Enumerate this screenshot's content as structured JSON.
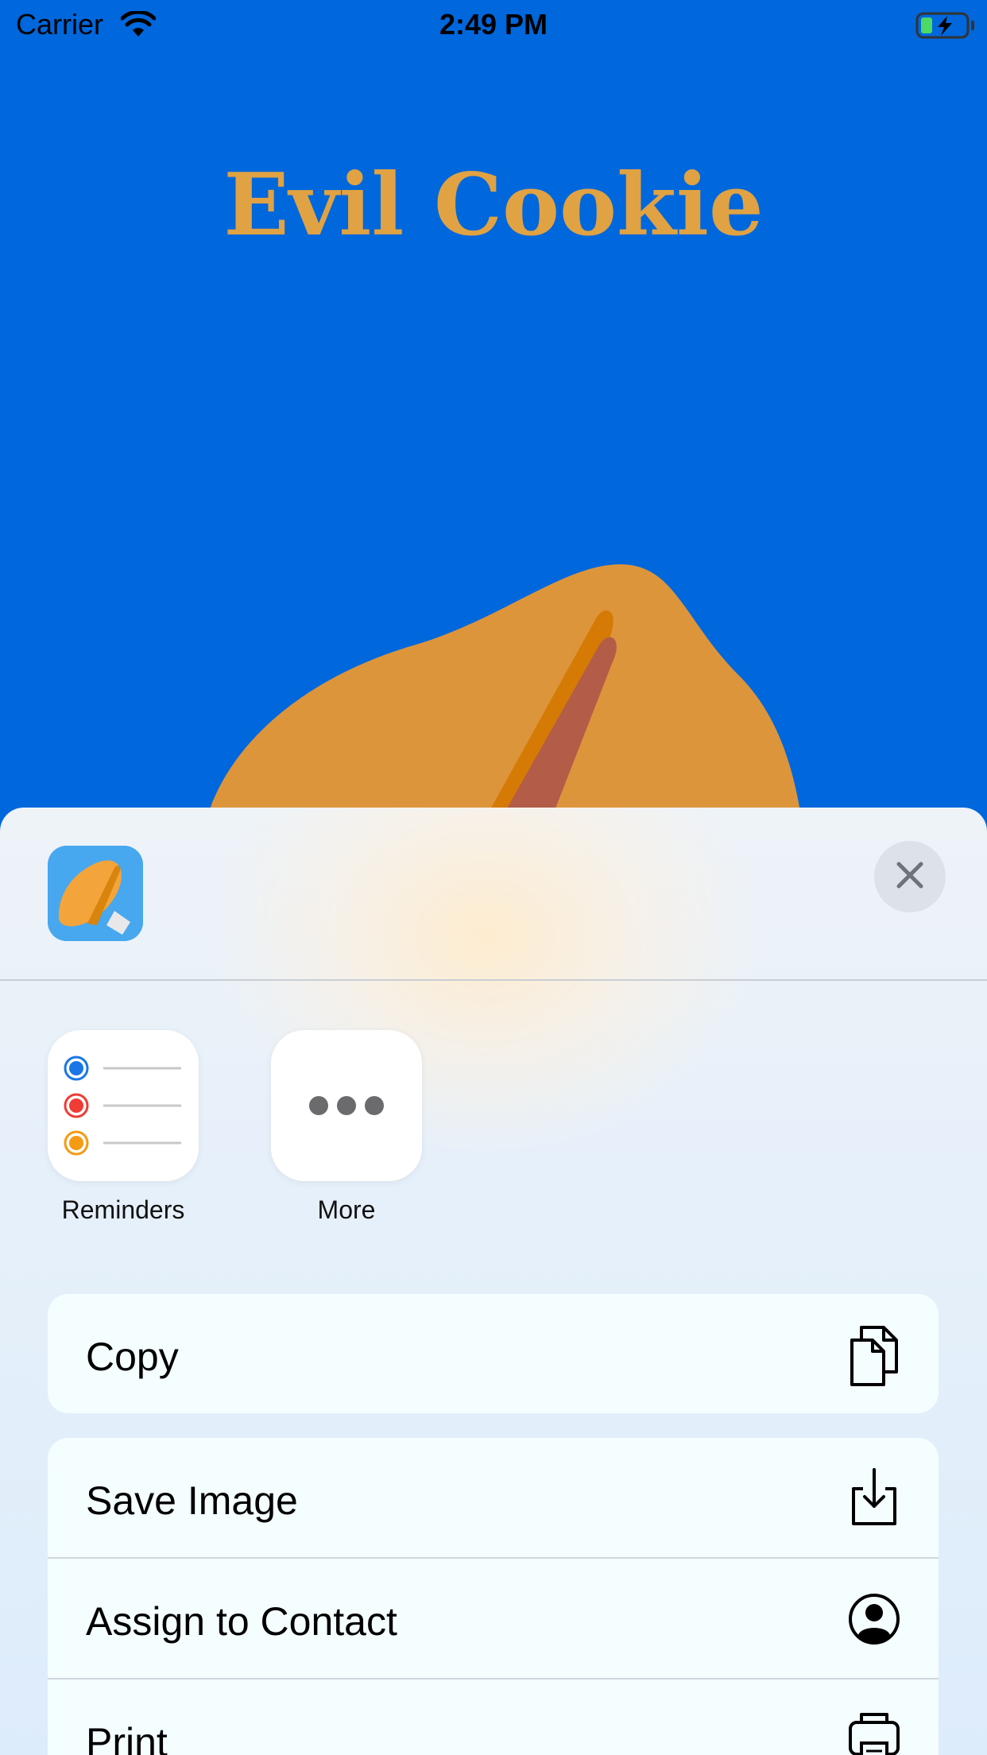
{
  "status_bar": {
    "carrier": "Carrier",
    "time": "2:49 PM"
  },
  "app": {
    "title": "Evil Cookie"
  },
  "share_sheet": {
    "apps": [
      {
        "label": "Reminders",
        "icon": "reminders-icon"
      },
      {
        "label": "More",
        "icon": "more-icon"
      }
    ],
    "actions": [
      {
        "label": "Copy",
        "icon": "copy-icon"
      },
      {
        "label": "Save Image",
        "icon": "save-image-icon"
      },
      {
        "label": "Assign to Contact",
        "icon": "contact-icon"
      },
      {
        "label": "Print",
        "icon": "print-icon"
      }
    ]
  },
  "colors": {
    "background": "#0067dc",
    "title": "#e0a242",
    "cookie": "#dd953b"
  }
}
